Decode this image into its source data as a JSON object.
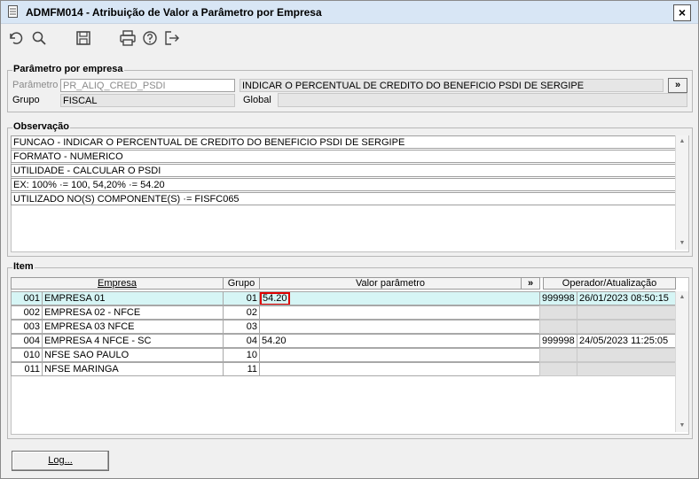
{
  "window": {
    "title": "ADMFM014 - Atribuição de Valor a Parâmetro por Empresa",
    "close": "×"
  },
  "toolbar": {
    "icons": [
      "undo-icon",
      "search-icon",
      "save-icon",
      "print-icon",
      "help-icon",
      "exit-icon"
    ]
  },
  "parametro_group": {
    "title": "Parâmetro por empresa",
    "parametro_label": "Parâmetro",
    "parametro_value": "PR_ALIQ_CRED_PSDI",
    "descricao_value": "INDICAR O PERCENTUAL DE CREDITO DO BENEFICIO PSDI DE SERGIPE",
    "expand_label": "»",
    "grupo_label": "Grupo",
    "grupo_value": "FISCAL",
    "global_label": "Global",
    "global_value": ""
  },
  "observacao": {
    "title": "Observação",
    "lines": [
      "FUNCAO - INDICAR O PERCENTUAL DE CREDITO DO BENEFICIO PSDI DE SERGIPE",
      "FORMATO - NUMERICO",
      "UTILIDADE - CALCULAR O PSDI",
      "EX: 100% ·= 100, 54,20% ·= 54.20",
      "UTILIZADO NO(S) COMPONENTE(S) ·= FISFC065"
    ]
  },
  "item": {
    "title": "Item",
    "columns": {
      "empresa": "Empresa",
      "grupo": "Grupo",
      "valor": "Valor parâmetro",
      "expand": "»",
      "operador": "Operador/Atualização"
    },
    "rows": [
      {
        "code": "001",
        "empresa": "EMPRESA 01",
        "grupo": "01",
        "valor": "54.20",
        "operador": "999998",
        "atualizacao": "26/01/2023 08:50:15"
      },
      {
        "code": "002",
        "empresa": "EMPRESA 02 - NFCE",
        "grupo": "02",
        "valor": "",
        "operador": "",
        "atualizacao": ""
      },
      {
        "code": "003",
        "empresa": "EMPRESA 03 NFCE",
        "grupo": "03",
        "valor": "",
        "operador": "",
        "atualizacao": ""
      },
      {
        "code": "004",
        "empresa": "EMPRESA 4 NFCE - SC",
        "grupo": "04",
        "valor": "54.20",
        "operador": "999998",
        "atualizacao": "24/05/2023 11:25:05"
      },
      {
        "code": "010",
        "empresa": "NFSE SAO PAULO",
        "grupo": "10",
        "valor": "",
        "operador": "",
        "atualizacao": ""
      },
      {
        "code": "011",
        "empresa": "NFSE MARINGA",
        "grupo": "11",
        "valor": "",
        "operador": "",
        "atualizacao": ""
      }
    ]
  },
  "footer": {
    "log_button": "Log..."
  },
  "colors": {
    "title_bar": "#d8e6f5",
    "selected_row": "#d6f5f5",
    "highlight_border": "#e00000"
  }
}
